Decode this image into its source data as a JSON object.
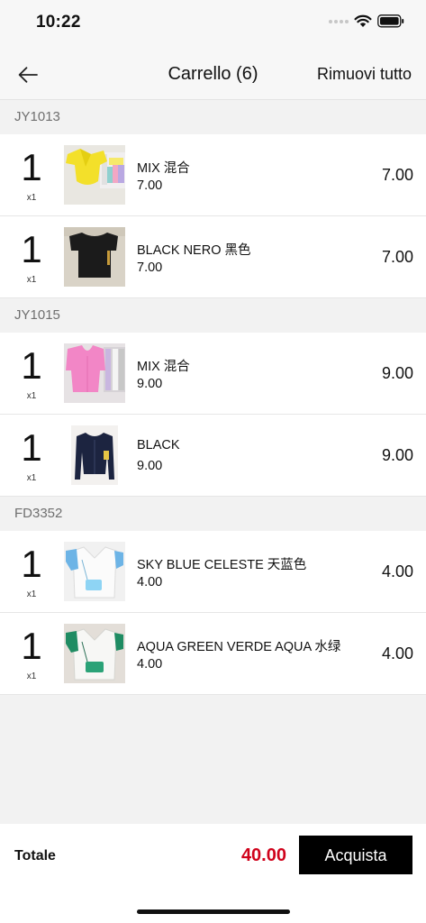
{
  "status_bar": {
    "time": "10:22",
    "icons": [
      "signal-dots-icon",
      "wifi-icon",
      "battery-icon"
    ]
  },
  "nav": {
    "back_icon": "arrow-left-icon",
    "title": "Carrello (6)",
    "action_label": "Rimuovi tutto"
  },
  "groups": [
    {
      "code": "JY1013",
      "items": [
        {
          "qty": "1",
          "mult": "x1",
          "name": "MIX 混合",
          "unit_price": "7.00",
          "total": "7.00",
          "image": "yellow-crop-top-image"
        },
        {
          "qty": "1",
          "mult": "x1",
          "name": "BLACK NERO 黑色",
          "unit_price": "7.00",
          "total": "7.00",
          "image": "black-top-image"
        }
      ]
    },
    {
      "code": "JY1015",
      "items": [
        {
          "qty": "1",
          "mult": "x1",
          "name": "MIX 混合",
          "unit_price": "9.00",
          "total": "9.00",
          "image": "pink-cardigan-image"
        },
        {
          "qty": "1",
          "mult": "x1",
          "name": "BLACK",
          "unit_price": "9.00",
          "total": "9.00",
          "image": "navy-cardigan-image"
        }
      ]
    },
    {
      "code": "FD3352",
      "items": [
        {
          "qty": "1",
          "mult": "x1",
          "name": "SKY BLUE CELESTE 天蓝色",
          "unit_price": "4.00",
          "total": "4.00",
          "image": "sky-blue-set-image"
        },
        {
          "qty": "1",
          "mult": "x1",
          "name": "AQUA GREEN VERDE AQUA 水绿",
          "unit_price": "4.00",
          "total": "4.00",
          "image": "aqua-green-set-image"
        }
      ]
    }
  ],
  "footer": {
    "total_label": "Totale",
    "total_value": "40.00",
    "buy_label": "Acquista"
  },
  "colors": {
    "accent": "#d0021b",
    "button_bg": "#000000",
    "background": "#f2f2f2"
  }
}
